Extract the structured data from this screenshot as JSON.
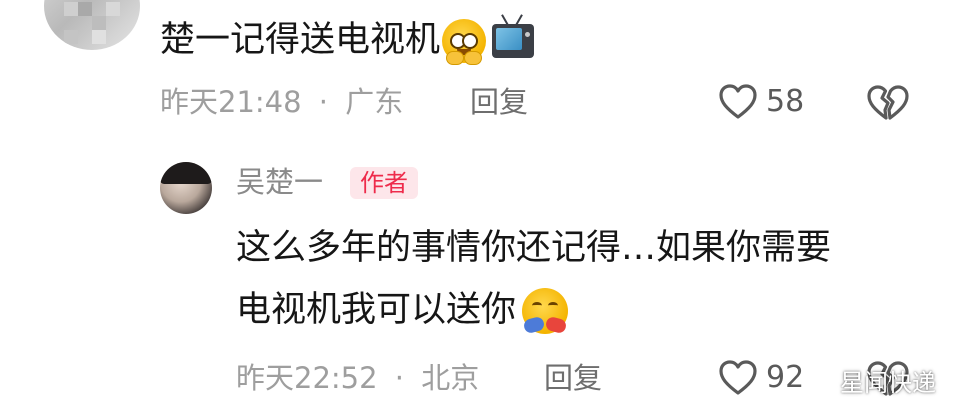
{
  "comment": {
    "text": "楚一记得送电视机",
    "emojis": [
      "pleading-face-emoji",
      "television-emoji"
    ],
    "timestamp": "昨天21:48",
    "separator": "·",
    "location": "广东",
    "reply_label": "回复",
    "like_count": "58"
  },
  "author_reply": {
    "author_name": "吴楚一",
    "author_badge": "作者",
    "text_line1": "这么多年的事情你还记得…如果你需要",
    "text_line2": "电视机我可以送你",
    "emoji": "hugging-face-emoji",
    "timestamp": "昨天22:52",
    "separator": "·",
    "location": "北京",
    "reply_label": "回复",
    "like_count": "92"
  },
  "watermark": {
    "text": "星闻快递"
  },
  "colors": {
    "badge_bg": "#fde6ea",
    "badge_text": "#ee2b4b",
    "meta_text": "#9e9e9e",
    "body_text": "#161616"
  }
}
